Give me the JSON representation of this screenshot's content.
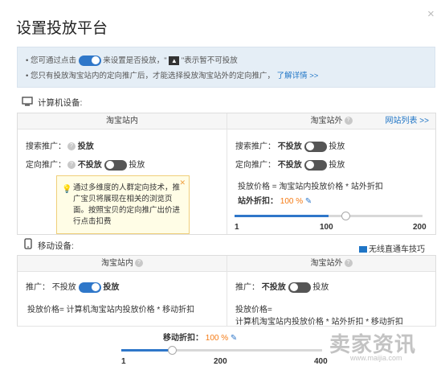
{
  "dialog": {
    "title": "设置投放平台",
    "close": "×"
  },
  "tips": {
    "line1_before": "您可通过点击",
    "line1_after": "来设置是否投放，\"",
    "line1_end": "\"表示暂不可投放",
    "line2": "您只有投放淘宝站内的定向推广后，才能选择投放淘宝站外的定向推广，",
    "line2_link": "了解详情 >>"
  },
  "pc": {
    "header": "计算机设备:",
    "inside": {
      "title": "淘宝站内",
      "search_label": "搜索推广：",
      "search_value": "投放",
      "target_label": "定向推广：",
      "target_off": "不投放",
      "target_on": "投放"
    },
    "tooltip": "通过多维度的人群定向技术，推广宝贝将展现在相关的浏览页面。按照宝贝的定向推广出价进行点击扣费",
    "outside": {
      "title": "淘宝站外",
      "site_link": "网站列表 >>",
      "search_label": "搜索推广：",
      "search_off": "不投放",
      "search_on": "投放",
      "target_label": "定向推广：",
      "target_off": "不投放",
      "target_on": "投放",
      "formula": "投放价格 = 淘宝站内投放价格 * 站外折扣",
      "discount_label": "站外折扣：",
      "discount_value": "100 %",
      "slider_level": 0.5,
      "ticks": [
        "1",
        "100",
        "200"
      ]
    }
  },
  "mobile": {
    "header": "移动设备:",
    "video_link": "无线直通车技巧",
    "inside": {
      "title": "淘宝站内",
      "label": "推广：",
      "off": "不投放",
      "on": "投放",
      "formula": "投放价格= 计算机淘宝站内投放价格 * 移动折扣"
    },
    "outside": {
      "title": "淘宝站外",
      "label": "推广：",
      "off": "不投放",
      "on": "投放",
      "formula1": "投放价格=",
      "formula2": "计算机淘宝站内投放价格 * 站外折扣 * 移动折扣"
    },
    "discount_label": "移动折扣：",
    "discount_value": "100 %",
    "slider_level": 0.25,
    "ticks": [
      "1",
      "200",
      "400"
    ]
  },
  "watermark": {
    "main": "卖家资讯",
    "sub": "www.maijia.com"
  }
}
